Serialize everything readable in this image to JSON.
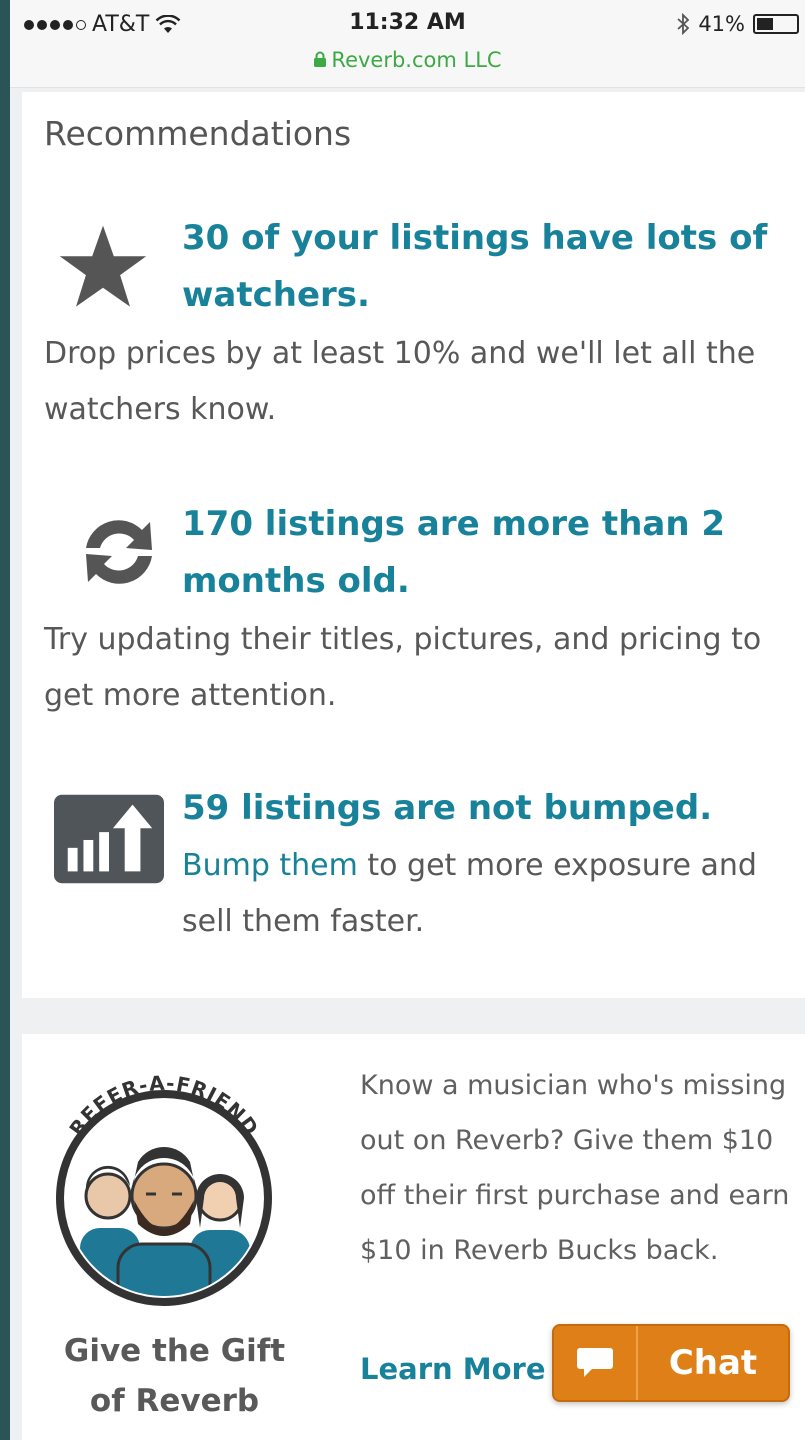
{
  "status_bar": {
    "carrier": "AT&T",
    "time": "11:32 AM",
    "battery": "41%",
    "battery_level": 0.41,
    "url": "Reverb.com LLC"
  },
  "recommendations": {
    "title": "Recommendations",
    "items": [
      {
        "icon": "star-icon",
        "headline": "30 of your listings have lots of watchers.",
        "body": "Drop prices by at least 10% and we'll let all the watchers know."
      },
      {
        "icon": "refresh-icon",
        "headline": "170 listings are more than 2 months old.",
        "body": "Try updating their titles, pictures, and pricing to get more attention."
      },
      {
        "icon": "bump-chart-icon",
        "headline": "59 listings are not bumped.",
        "body_link": "Bump them",
        "body_rest": " to get more exposure and sell them faster."
      }
    ]
  },
  "refer": {
    "logo_text": "REFER-A-FRIEND",
    "gift_title": "Give the Gift of Reverb",
    "description": "Know a musician who's missing out on Reverb? Give them $10 off their first purchase and earn $10 in Reverb Bucks back.",
    "learn_more": "Learn More"
  },
  "chat": {
    "label": "Chat",
    "color": "#df7f18"
  },
  "colors": {
    "accent": "#17829a",
    "secure_green": "#3da945"
  }
}
